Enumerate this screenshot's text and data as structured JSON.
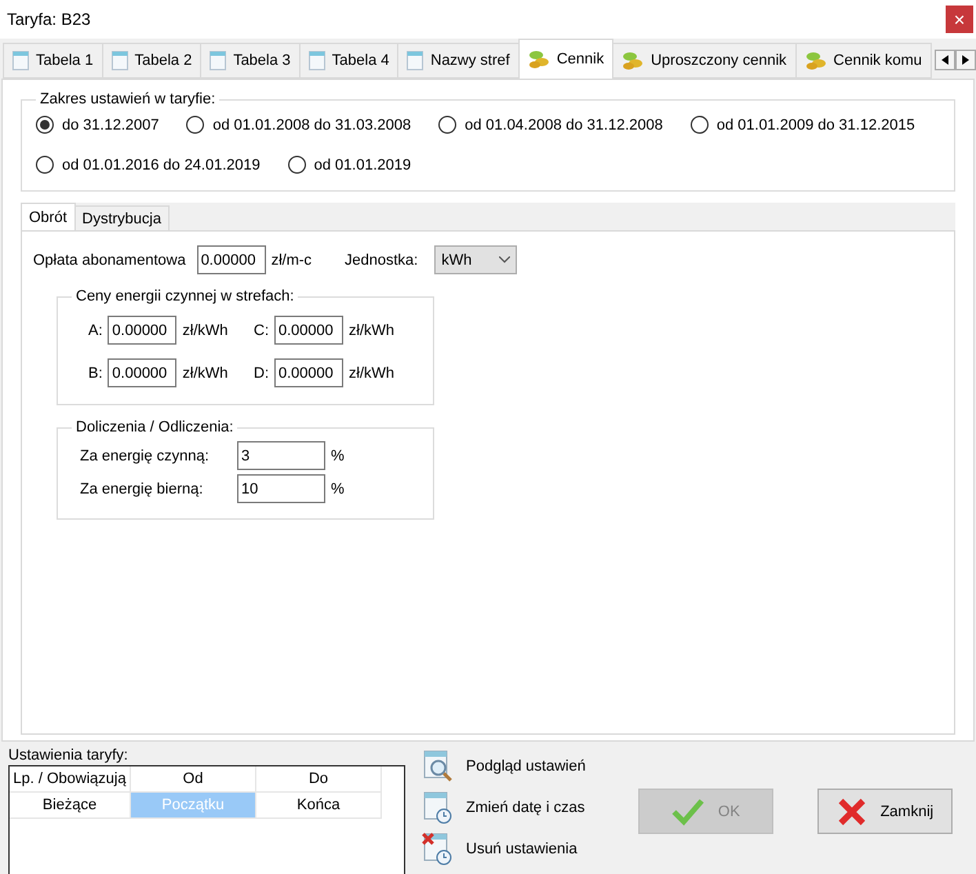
{
  "window": {
    "title": "Taryfa: B23",
    "close": "×"
  },
  "tabs": [
    {
      "label": "Tabela 1",
      "kind": "page",
      "selected": false
    },
    {
      "label": "Tabela 2",
      "kind": "page",
      "selected": false
    },
    {
      "label": "Tabela 3",
      "kind": "page",
      "selected": false
    },
    {
      "label": "Tabela 4",
      "kind": "page",
      "selected": false
    },
    {
      "label": "Nazwy stref",
      "kind": "page",
      "selected": false
    },
    {
      "label": "Cennik",
      "kind": "coins",
      "selected": true
    },
    {
      "label": "Uproszczony cennik",
      "kind": "coins",
      "selected": false
    },
    {
      "label": "Cennik komu",
      "kind": "coins",
      "selected": false
    }
  ],
  "range_group": {
    "title": "Zakres ustawień w taryfie:",
    "options": [
      {
        "label": "do 31.12.2007",
        "selected": true
      },
      {
        "label": "od 01.01.2008 do 31.03.2008",
        "selected": false
      },
      {
        "label": "od 01.04.2008 do 31.12.2008",
        "selected": false
      },
      {
        "label": "od 01.01.2009 do 31.12.2015",
        "selected": false
      },
      {
        "label": "od 01.01.2016 do 24.01.2019",
        "selected": false
      },
      {
        "label": "od 01.01.2019",
        "selected": false
      }
    ]
  },
  "subtabs": [
    {
      "label": "Obrót",
      "selected": true
    },
    {
      "label": "Dystrybucja",
      "selected": false
    }
  ],
  "fee": {
    "label": "Opłata abonamentowa",
    "value": "0.00000",
    "unit": "zł/m-c"
  },
  "unit_select": {
    "label": "Jednostka:",
    "value": "kWh"
  },
  "prices": {
    "title": "Ceny energii czynnej w strefach:",
    "fields": [
      {
        "label": "A:",
        "value": "0.00000",
        "unit": "zł/kWh"
      },
      {
        "label": "C:",
        "value": "0.00000",
        "unit": "zł/kWh"
      },
      {
        "label": "B:",
        "value": "0.00000",
        "unit": "zł/kWh"
      },
      {
        "label": "D:",
        "value": "0.00000",
        "unit": "zł/kWh"
      }
    ]
  },
  "adjustments": {
    "title": "Doliczenia / Odliczenia:",
    "rows": [
      {
        "label": "Za energię czynną:",
        "value": "3",
        "unit": "%"
      },
      {
        "label": "Za energię bierną:",
        "value": "10",
        "unit": "%"
      }
    ]
  },
  "settings": {
    "title": "Ustawienia taryfy:",
    "columns": [
      "Lp. / Obowiązują",
      "Od",
      "Do"
    ],
    "rows": [
      {
        "cells": [
          {
            "text": "Bieżące",
            "selected": false
          },
          {
            "text": "Początku",
            "selected": true
          },
          {
            "text": "Końca",
            "selected": false
          }
        ]
      }
    ]
  },
  "actions": [
    {
      "label": "Podgląd ustawień",
      "kind": "preview"
    },
    {
      "label": "Zmień datę i czas",
      "kind": "change-date"
    },
    {
      "label": "Usuń ustawienia",
      "kind": "delete"
    }
  ],
  "buttons": [
    {
      "label": "OK",
      "kind": "ok",
      "disabled": true
    },
    {
      "label": "Zamknij",
      "kind": "close",
      "disabled": false
    }
  ]
}
